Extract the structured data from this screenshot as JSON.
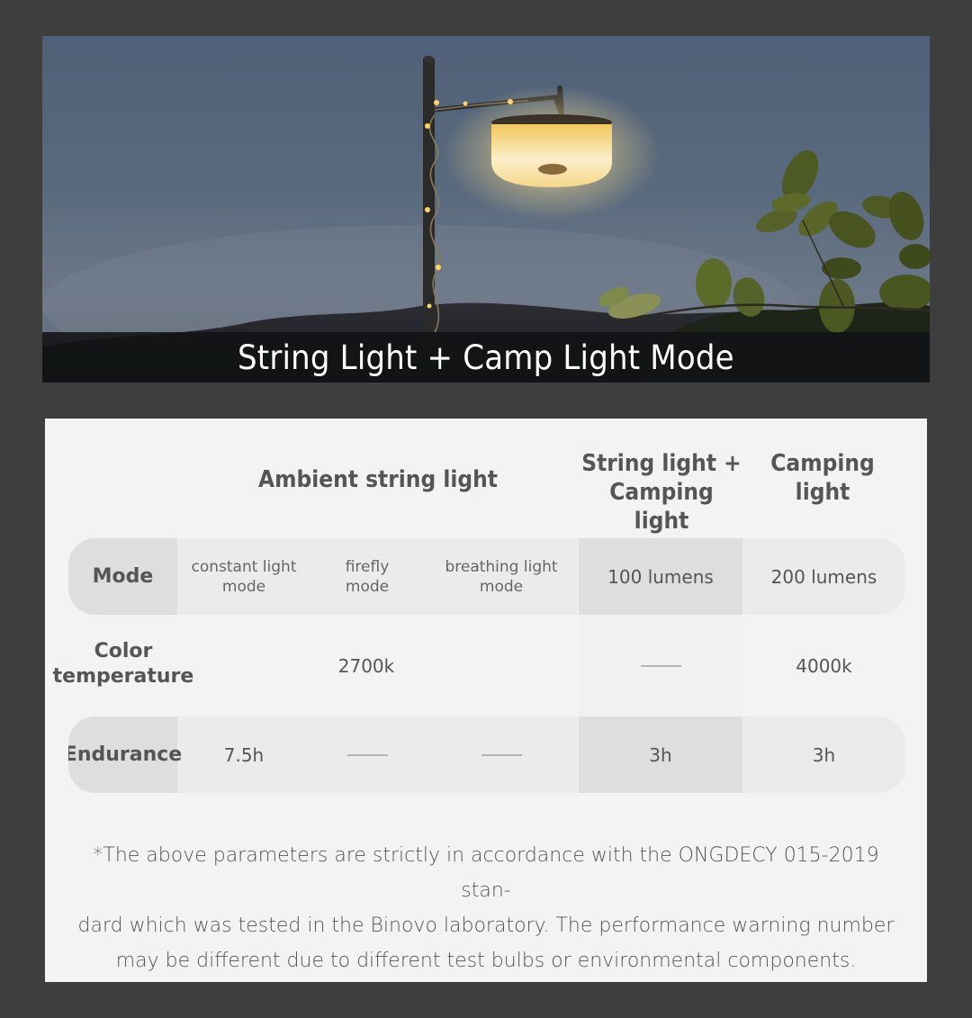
{
  "hero": {
    "caption": "String Light + Camp Light Mode",
    "image_description": "camp lamp hanging from pole wrapped with string lights at dusk, with leaves",
    "colors": {
      "sky": "#55657b",
      "lamp_glow": "#f5d27a",
      "caption_bar": "#141416"
    }
  },
  "table": {
    "column_headers": {
      "ambient": "Ambient string light",
      "combo_line1": "String light +",
      "combo_line2": "Camping light",
      "camping_line1": "Camping",
      "camping_line2": "light"
    },
    "rows": {
      "mode": {
        "label": "Mode",
        "constant": [
          "constant light",
          "mode"
        ],
        "firefly": [
          "firefly",
          "mode"
        ],
        "breathing": [
          "breathing light",
          "mode"
        ],
        "combo": "100 lumens",
        "camping": "200 lumens"
      },
      "color_temperature": {
        "label_line1": "Color",
        "label_line2": "temperature",
        "ambient": "2700k",
        "combo": "—",
        "camping": "4000k"
      },
      "endurance": {
        "label": "Endurance",
        "constant": "7.5h",
        "firefly": "—",
        "breathing": "—",
        "combo": "3h",
        "camping": "3h"
      }
    }
  },
  "footnote": {
    "line1": "*The above parameters are strictly in accordance with the ONGDECY 015-2019 stan-",
    "line2": "dard which was tested in the Binovo laboratory. The performance warning number",
    "line3": "may be different due to different test bulbs or environmental components."
  },
  "colors": {
    "page_background": "#3e3e3e",
    "panel_background": "#f3f3f3",
    "band": "#ebebeb",
    "band_highlight": "#dededf",
    "text": "#555555"
  }
}
